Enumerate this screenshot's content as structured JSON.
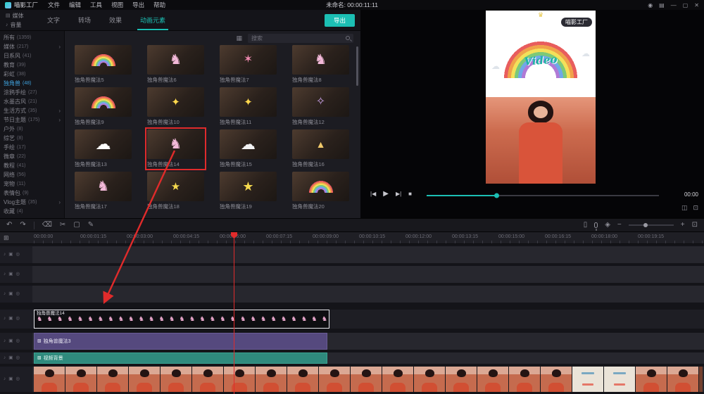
{
  "colors": {
    "accent": "#1cbfb4",
    "annot": "#e02b2b",
    "clip-purple": "#55497e",
    "clip-teal": "#2f8a7d",
    "sidebar-active": "#3e9fd9"
  },
  "titlebar": {
    "app_name": "喵影工厂",
    "document_title": "未命名: 00:00:11:11",
    "menus": [
      "文件",
      "编辑",
      "工具",
      "视图",
      "导出",
      "帮助"
    ],
    "window_controls": [
      "user",
      "layout",
      "minimize",
      "maximize",
      "close"
    ]
  },
  "ribbon": {
    "side_tabs": [
      "媒体",
      "音量"
    ],
    "tabs": [
      "文字",
      "转场",
      "效果",
      "动画元素"
    ],
    "active_tab": "动画元素",
    "export_button": "导出"
  },
  "category_panel": {
    "items": [
      {
        "label": "所有",
        "count": "(1359)"
      },
      {
        "label": "媒体",
        "count": "(217)",
        "chevron": true
      },
      {
        "label": "日系风",
        "count": "(41)"
      },
      {
        "label": "教育",
        "count": "(39)"
      },
      {
        "label": "彩虹",
        "count": "(38)"
      },
      {
        "label": "独角兽",
        "count": "(48)",
        "active": true
      },
      {
        "label": "涂鸦手绘",
        "count": "(27)"
      },
      {
        "label": "水墨古风",
        "count": "(21)"
      },
      {
        "label": "生活方式",
        "count": "(35)",
        "chevron": true
      },
      {
        "label": "节日主题",
        "count": "(175)",
        "chevron": true
      },
      {
        "label": "户外",
        "count": "(8)"
      },
      {
        "label": "综艺",
        "count": "(8)"
      },
      {
        "label": "手绘",
        "count": "(17)"
      },
      {
        "label": "微章",
        "count": "(22)"
      },
      {
        "label": "教程",
        "count": "(41)"
      },
      {
        "label": "网络",
        "count": "(56)"
      },
      {
        "label": "宠物",
        "count": "(11)"
      },
      {
        "label": "表情包",
        "count": "(9)"
      },
      {
        "label": "Vlog主题",
        "count": "(35)",
        "chevron": true
      },
      {
        "label": "收藏",
        "count": "(4)"
      }
    ]
  },
  "library": {
    "search_placeholder": "搜索",
    "selected_item": "独角兽魔法14",
    "items": [
      {
        "name": "独角兽魔法5",
        "icon": "rainbow-sticker"
      },
      {
        "name": "独角兽魔法6",
        "icon": "unicorn-sticker"
      },
      {
        "name": "独角兽魔法7",
        "icon": "banner-sticker"
      },
      {
        "name": "独角兽魔法8",
        "icon": "unicorn-sticker"
      },
      {
        "name": "独角兽魔法9",
        "icon": "rainbow-sticker"
      },
      {
        "name": "独角兽魔法10",
        "icon": "sparkle-sticker"
      },
      {
        "name": "独角兽魔法11",
        "icon": "sparkle-sticker"
      },
      {
        "name": "独角兽魔法12",
        "icon": "magic-sticker"
      },
      {
        "name": "独角兽魔法13",
        "icon": "speech-bubble-sticker"
      },
      {
        "name": "独角兽魔法14",
        "icon": "unicorn-sticker",
        "selected": true
      },
      {
        "name": "独角兽魔法15",
        "icon": "cloud-sticker"
      },
      {
        "name": "独角兽魔法16",
        "icon": "horn-sticker"
      },
      {
        "name": "独角兽魔法17",
        "icon": "unicorn-sticker"
      },
      {
        "name": "独角兽魔法18",
        "icon": "shooting-star-sticker"
      },
      {
        "name": "独角兽魔法19",
        "icon": "star-sticker"
      },
      {
        "name": "独角兽魔法20",
        "icon": "rainbow-sticker"
      }
    ]
  },
  "preview": {
    "video_overlay": {
      "badge": "喵影工厂",
      "title": "Video"
    },
    "time_display": "00:00",
    "controls": [
      "previous-frame",
      "play",
      "next-frame",
      "stop"
    ],
    "corner_icons": [
      "snapshot",
      "fullscreen"
    ]
  },
  "timeline": {
    "toolbar_left": [
      "undo",
      "redo",
      "delete",
      "cut",
      "crop",
      "edit"
    ],
    "toolbar_right": [
      "device",
      "voiceover",
      "marker",
      "zoom-out",
      "zoom-in",
      "fit"
    ],
    "ruler_labels": [
      "00:00:00",
      "00:00:01:15",
      "00:00:03:00",
      "00:00:04:15",
      "00:00:06:00",
      "00:00:07:15",
      "00:00:09:00",
      "00:00:10:15",
      "00:00:12:00",
      "00:00:13:15",
      "00:00:15:00",
      "00:00:16:15",
      "00:00:18:00",
      "00:00:19:15"
    ],
    "clips": {
      "sticker": {
        "label": "独角兽魔法14"
      },
      "text_sticker": {
        "label": "独角兽魔法3"
      },
      "background": {
        "label": "视频背景"
      }
    }
  }
}
